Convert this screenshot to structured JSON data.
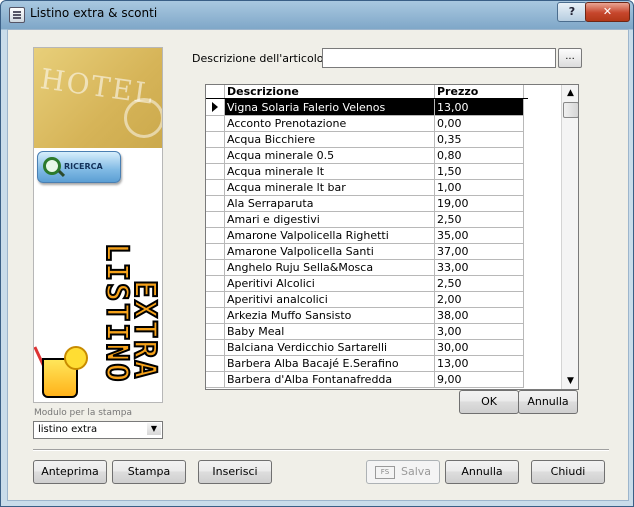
{
  "window": {
    "title": "Listino extra & sconti",
    "help_label": "?",
    "close_label": "✕"
  },
  "banner": {
    "ricerca_label": "RICERCA",
    "word1": "LISTINO",
    "word2": "EXTRA",
    "hotel_text": "HOTEL"
  },
  "stampa": {
    "label": "Modulo per la stampa",
    "value": "listino extra"
  },
  "search": {
    "label": "Descrizione dell'articolo:",
    "value": "",
    "browse_label": "..."
  },
  "grid": {
    "columns": [
      "Descrizione",
      "Prezzo"
    ],
    "rows": [
      [
        "Vigna Solaria Falerio Velenos",
        "13,00"
      ],
      [
        "Acconto Prenotazione",
        "0,00"
      ],
      [
        "Acqua Bicchiere",
        "0,35"
      ],
      [
        "Acqua minerale  0.5",
        "0,80"
      ],
      [
        "Acqua minerale lt",
        "1,50"
      ],
      [
        "Acqua minerale lt bar",
        "1,00"
      ],
      [
        "Ala Serraparuta",
        "19,00"
      ],
      [
        "Amari e digestivi",
        "2,50"
      ],
      [
        "Amarone Valpolicella Righetti",
        "35,00"
      ],
      [
        "Amarone Valpolicella Santi",
        "37,00"
      ],
      [
        "Anghelo Ruju Sella&Mosca",
        "33,00"
      ],
      [
        "Aperitivi Alcolici",
        "2,50"
      ],
      [
        "Aperitivi analcolici",
        "2,00"
      ],
      [
        "Arkezia Muffo Sansisto",
        "38,00"
      ],
      [
        "Baby Meal",
        "3,00"
      ],
      [
        "Balciana Verdicchio Sartarelli",
        "30,00"
      ],
      [
        "Barbera Alba Bacajé E.Serafino",
        "13,00"
      ],
      [
        "Barbera d'Alba Fontanafredda",
        "9,00"
      ]
    ],
    "selected_row": 0
  },
  "dialog_buttons": {
    "ok": "OK",
    "annulla": "Annulla"
  },
  "toolbar": {
    "anteprima": "Anteprima",
    "stampa": "Stampa",
    "inserisci": "Inserisci",
    "salva": "Salva",
    "salva_icon": "FS",
    "annulla": "Annulla",
    "chiudi": "Chiudi"
  }
}
